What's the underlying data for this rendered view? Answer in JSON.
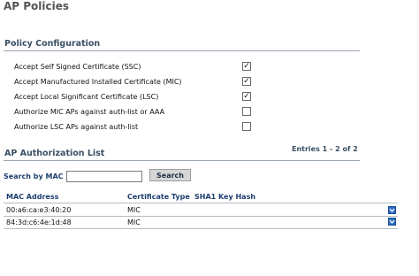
{
  "page": {
    "title": "AP Policies"
  },
  "policy_configuration": {
    "title": "Policy Configuration",
    "items": [
      {
        "label": "Accept Self Signed Certificate (SSC)",
        "checked": true
      },
      {
        "label": "Accept Manufactured Installed Certificate (MIC)",
        "checked": true
      },
      {
        "label": "Accept Local Significant Certificate (LSC)",
        "checked": true
      },
      {
        "label": "Authorize MIC APs against auth-list or AAA",
        "checked": false
      },
      {
        "label": "Authorize LSC APs against auth-list",
        "checked": false
      }
    ]
  },
  "authorization_list": {
    "title": "AP Authorization List",
    "entries_text": "Entries 1 - 2 of 2",
    "search_label": "Search by MAC",
    "search_value": "",
    "search_button": "Search",
    "columns": [
      "MAC Address",
      "Certificate Type",
      "SHA1 Key Hash"
    ],
    "rows": [
      {
        "mac": "00:a6:ca:e3:40:20",
        "cert_type": "MIC",
        "sha1": "",
        "action_icon": "chevron-down-icon"
      },
      {
        "mac": "84:3d:c6:4e:1d:48",
        "cert_type": "MIC",
        "sha1": "",
        "action_icon": "chevron-down-icon"
      }
    ]
  },
  "colors": {
    "section_title": "#3a4f64",
    "link_blue": "#1c3e6e",
    "dropdown_blue": "#2a6dc2"
  }
}
